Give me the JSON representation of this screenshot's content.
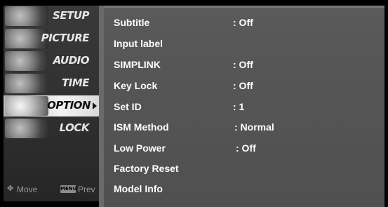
{
  "sidebar": {
    "items": [
      {
        "label": "SETUP"
      },
      {
        "label": "PICTURE"
      },
      {
        "label": "AUDIO"
      },
      {
        "label": "TIME"
      },
      {
        "label": "OPTION"
      },
      {
        "label": "LOCK"
      }
    ],
    "active_item": "OPTION"
  },
  "footer": {
    "move_label": "Move",
    "menu_key_label": "MENU",
    "prev_label": "Prev"
  },
  "options": {
    "rows": [
      {
        "name": "Subtitle",
        "value": ": Off"
      },
      {
        "name": "Input label",
        "value": ""
      },
      {
        "name": "SIMPLINK",
        "value": ": Off"
      },
      {
        "name": "Key Lock",
        "value": ": Off"
      },
      {
        "name": "Set ID",
        "value": ": 1"
      },
      {
        "name": "ISM Method",
        "value": ": Normal"
      },
      {
        "name": "Low Power",
        "value": ": Off"
      },
      {
        "name": "Factory Reset",
        "value": ""
      },
      {
        "name": "Model Info",
        "value": ""
      }
    ]
  },
  "colors": {
    "panel_bg": "#555555",
    "sidebar_bg": "#303030",
    "active_bg": "#e8e8e8",
    "text": "#ffffff"
  }
}
